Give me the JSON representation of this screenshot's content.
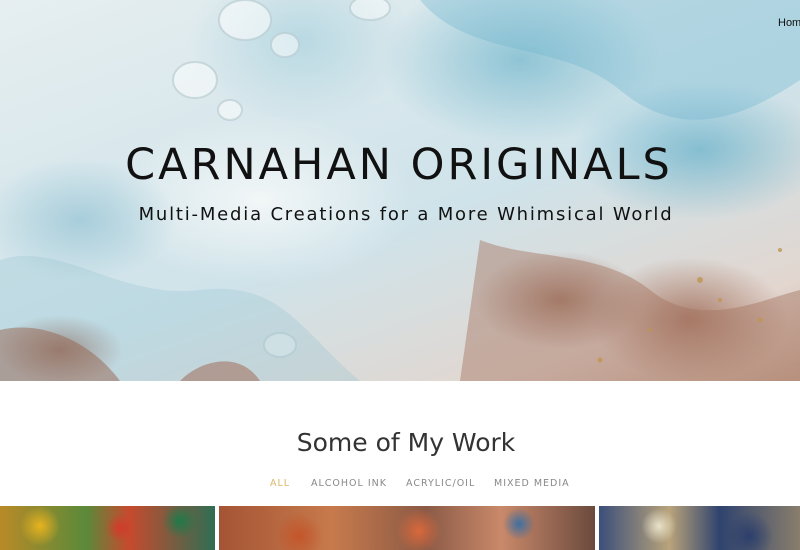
{
  "nav": {
    "home_label": "Hom"
  },
  "hero": {
    "title": "CARNAHAN ORIGINALS",
    "subtitle": "Multi-Media Creations for a More Whimsical World"
  },
  "work_section": {
    "title": "Some of My Work",
    "filters": [
      {
        "label": "ALL",
        "active": true
      },
      {
        "label": "ALCOHOL INK",
        "active": false
      },
      {
        "label": "ACRYLIC/OIL",
        "active": false
      },
      {
        "label": "MIXED MEDIA",
        "active": false
      }
    ],
    "active_color": "#d8b76a",
    "inactive_color": "#888888"
  },
  "gallery": {
    "items": [
      {
        "icon": "alcohol-ink-painting-image"
      },
      {
        "icon": "abstract-painting-image"
      },
      {
        "icon": "mixed-media-painting-image"
      }
    ]
  }
}
